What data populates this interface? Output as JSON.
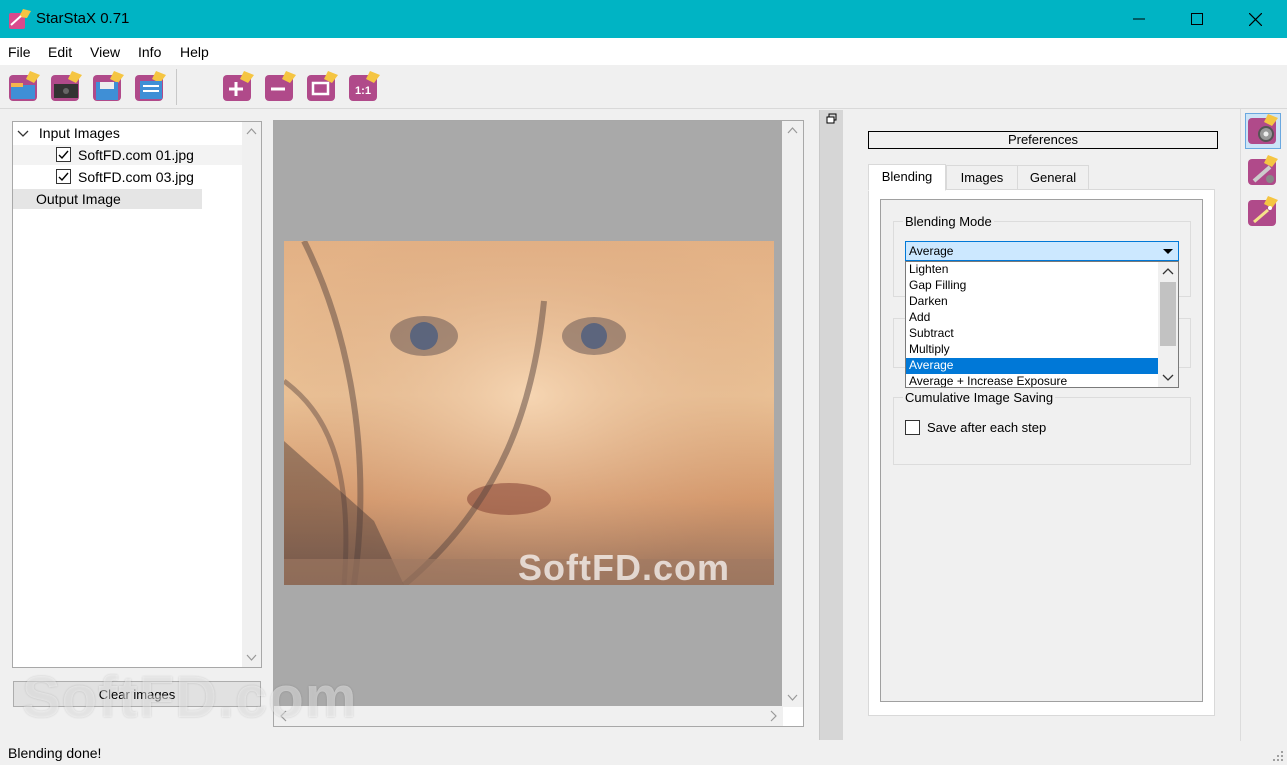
{
  "window": {
    "title": "StarStaX 0.71",
    "accent": "#00b4c4"
  },
  "menu": [
    "File",
    "Edit",
    "View",
    "Info",
    "Help"
  ],
  "toolbar": {
    "file_buttons": [
      "open-images-icon",
      "open-darkframe-icon",
      "save-image-icon",
      "stack-icon"
    ],
    "zoom_buttons": [
      "zoom-in-icon",
      "zoom-out-icon",
      "fit-to-window-icon",
      "actual-size-icon"
    ],
    "zoom_actual_label": "1:1"
  },
  "tree": {
    "input_label": "Input Images",
    "files": [
      {
        "name": "SoftFD.com 01.jpg",
        "checked": true
      },
      {
        "name": "SoftFD.com 03.jpg",
        "checked": true
      }
    ],
    "output_label": "Output Image"
  },
  "clear_button": "Clear images",
  "preferences": {
    "header": "Preferences",
    "tabs": [
      "Blending",
      "Images",
      "General"
    ],
    "active_tab": "Blending",
    "blending_mode_label": "Blending Mode",
    "blending_mode_value": "Average",
    "options": [
      "Lighten",
      "Gap Filling",
      "Darken",
      "Add",
      "Subtract",
      "Multiply",
      "Average",
      "Average + Increase Exposure"
    ],
    "cumulative_label": "Cumulative Image Saving",
    "save_each_step_label": "Save after each step",
    "save_each_step_checked": false
  },
  "side_tools": [
    "preferences-gear-icon",
    "tools-icon",
    "magic-wand-icon"
  ],
  "status": "Blending done!",
  "watermark": "SoftFD.com"
}
